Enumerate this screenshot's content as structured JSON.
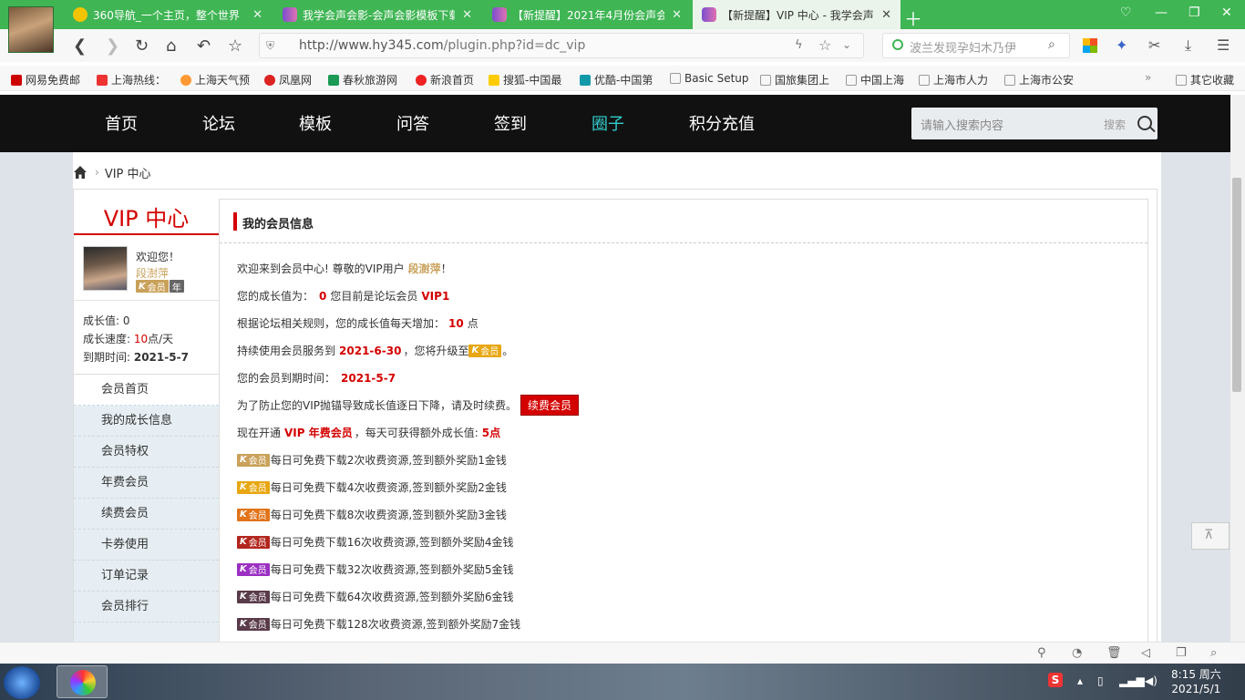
{
  "browser": {
    "tabs": [
      {
        "title": "360导航_一个主页，整个世界"
      },
      {
        "title": "我学会声会影-会声会影模板下载"
      },
      {
        "title": "【新提醒】2021年4月份会声会影"
      },
      {
        "title": "【新提醒】VIP 中心 - 我学会声"
      }
    ],
    "url_host": "http://www.hy345.com",
    "url_path": "/plugin.php?id=dc_vip",
    "search_placeholder": "波兰发现孕妇木乃伊",
    "bookmarks": [
      "网易免费邮",
      "上海热线：",
      "上海天气预",
      "凤凰网",
      "春秋旅游网",
      "新浪首页",
      "搜狐-中国最",
      "优酷-中国第",
      "Basic Setup",
      "国旅集团上",
      "中国上海",
      "上海市人力",
      "上海市公安",
      "其它收藏"
    ]
  },
  "site": {
    "nav": [
      "首页",
      "论坛",
      "模板",
      "问答",
      "签到",
      "圈子",
      "积分充值"
    ],
    "search_placeholder": "请输入搜索内容",
    "search_label": "搜索",
    "breadcrumb": "VIP 中心",
    "vip_title": "VIP 中心",
    "welcome": "欢迎您！",
    "username": "段澍萍",
    "member_badge": "会员",
    "year_badge": "年",
    "growth_label": "成长值: 0",
    "speed_label": "成长速度: ",
    "speed_value": "10",
    "speed_unit": "点/天",
    "expire_label": "到期时间: ",
    "expire_value": "2021-5-7",
    "menu": [
      "会员首页",
      "我的成长信息",
      "会员特权",
      "年费会员",
      "续费会员",
      "卡券使用",
      "订单记录",
      "会员排行"
    ],
    "panel_title": "我的会员信息",
    "lines": {
      "l1a": "欢迎来到会员中心! 尊敬的VIP用户",
      "l1b": "段澍萍",
      "l1c": "！",
      "l2a": "您的成长值为：",
      "l2b": "0",
      "l2c": "您目前是论坛会员",
      "l2d": "VIP1",
      "l3a": "根据论坛相关规则，您的成长值每天增加：",
      "l3b": "10",
      "l3c": "点",
      "l4a": "持续使用会员服务到",
      "l4b": "2021-6-30",
      "l4c": "，您将升级至",
      "l4d": "。",
      "l5a": "您的会员到期时间：",
      "l5b": "2021-5-7",
      "l6a": "为了防止您的VIP抛锚导致成长值逐日下降，请及时续费。",
      "renew_button": "续费会员",
      "l7a": "现在开通",
      "l7b": "VIP 年费会员",
      "l7c": "，每天可获得额外成长值:",
      "l7d": "5点"
    },
    "levels": [
      {
        "text": "每日可免费下载2次收费资源,签到额外奖励1金钱",
        "color": "#c9a15a"
      },
      {
        "text": "每日可免费下载4次收费资源,签到额外奖励2金钱",
        "color": "#e8a712"
      },
      {
        "text": "每日可免费下载8次收费资源,签到额外奖励3金钱",
        "color": "#e2741a"
      },
      {
        "text": "每日可免费下载16次收费资源,签到额外奖励4金钱",
        "color": "#b3261e"
      },
      {
        "text": "每日可免费下载32次收费资源,签到额外奖励5金钱",
        "color": "#9b2fc2"
      },
      {
        "text": "每日可免费下载64次收费资源,签到额外奖励6金钱",
        "color": "#5a3b4a"
      },
      {
        "text": "每日可免费下载128次收费资源,签到额外奖励7金钱",
        "color": "#5a3b4a"
      }
    ]
  },
  "taskbar": {
    "time": "8:15 周六",
    "date": "2021/5/1"
  },
  "colors": {
    "accent_red": "#d40000",
    "nav_active": "#33cccc",
    "tab_green": "#3fb554"
  }
}
